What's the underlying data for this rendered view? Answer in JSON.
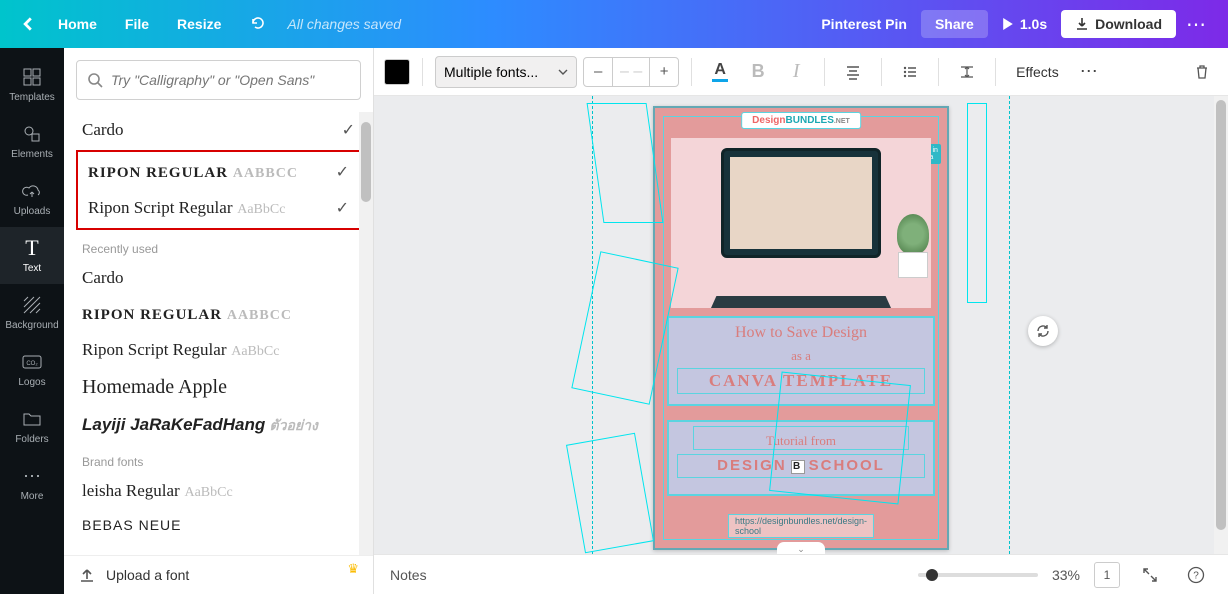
{
  "topbar": {
    "home": "Home",
    "file": "File",
    "resize": "Resize",
    "saved": "All changes saved",
    "docname": "Pinterest Pin",
    "share": "Share",
    "duration": "1.0s",
    "download": "Download"
  },
  "rail": {
    "items": [
      {
        "icon": "grid",
        "label": "Templates"
      },
      {
        "icon": "shapes",
        "label": "Elements"
      },
      {
        "icon": "cloud",
        "label": "Uploads"
      },
      {
        "icon": "T",
        "label": "Text"
      },
      {
        "icon": "hatch",
        "label": "Background"
      },
      {
        "icon": "co2",
        "label": "Logos"
      },
      {
        "icon": "folder",
        "label": "Folders"
      },
      {
        "icon": "dots",
        "label": "More"
      }
    ]
  },
  "fontpanel": {
    "placeholder": "Try \"Calligraphy\" or \"Open Sans\"",
    "selected": [
      {
        "name": "Cardo",
        "class": "f-serif",
        "sample": ""
      },
      {
        "name": "RIPON REGULAR",
        "class": "ripon",
        "sample": "AABBCC"
      },
      {
        "name": "Ripon Script Regular",
        "class": "f-script",
        "sample": "AaBbCc"
      }
    ],
    "recently_label": "Recently used",
    "recent": [
      {
        "name": "Cardo",
        "class": "f-serif",
        "sample": ""
      },
      {
        "name": "RIPON REGULAR",
        "class": "ripon",
        "sample": "AABBCC"
      },
      {
        "name": "Ripon Script Regular",
        "class": "f-script",
        "sample": "AaBbCc"
      },
      {
        "name": "Homemade Apple",
        "class": "f-script",
        "sample": ""
      },
      {
        "name": "Layiji JaRaKeFadHang",
        "class": "",
        "sample": "ตัวอย่าง",
        "style": "font-style:italic;font-weight:700;font-family:serif;"
      }
    ],
    "brand_label": "Brand fonts",
    "brand": [
      {
        "name": "leisha Regular",
        "class": "f-script",
        "sample": "AaBbCc"
      },
      {
        "name": "BEBAS NEUE",
        "class": "bebas",
        "sample": ""
      }
    ],
    "upload": "Upload a font"
  },
  "toolbar": {
    "font": "Multiple fonts...",
    "size": "– –",
    "effects": "Effects"
  },
  "pin": {
    "brand1": "Design",
    "brand2": "BUNDLES",
    "brand3": ".NET",
    "canva_tag": "Made in Canva",
    "title_script": "How to Save Design",
    "title_asa": "as a",
    "title_display": "CANVA TEMPLATE",
    "sub_script": "Tutorial from",
    "sub_display_a": "DESIGN",
    "sub_display_b": "SCHOOL",
    "url": "https://designbundles.net/design-school"
  },
  "bottom": {
    "notes": "Notes",
    "zoom": "33%",
    "page": "1"
  }
}
